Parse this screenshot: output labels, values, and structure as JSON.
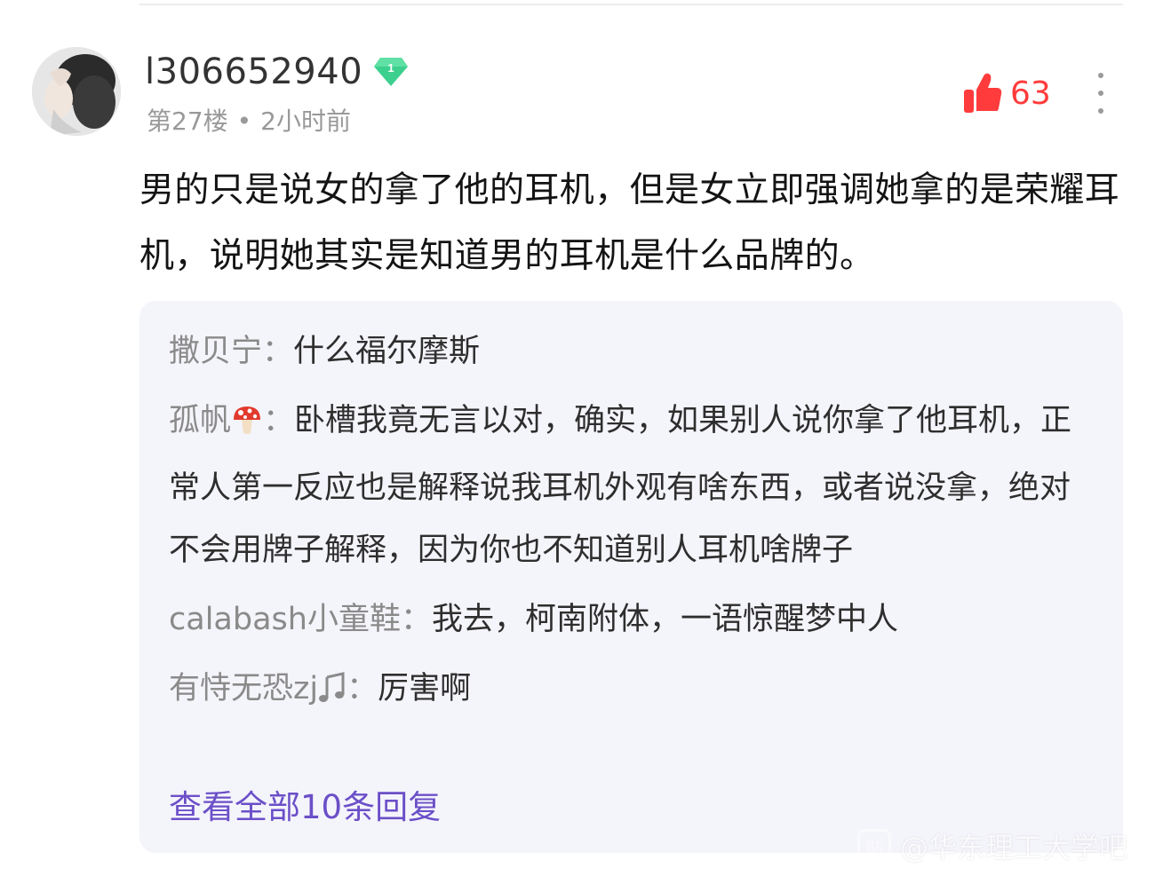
{
  "post": {
    "username": "l306652940",
    "level_badge": "1",
    "floor": "第27楼",
    "separator": "•",
    "time_ago": "2小时前",
    "like_count": "63",
    "content": "男的只是说女的拿了他的耳机，但是女立即强调她拿的是荣耀耳机，说明她其实是知道男的耳机是什么品牌的。"
  },
  "replies": [
    {
      "name": "撒贝宁",
      "colon": "：",
      "text": "什么福尔摩斯",
      "emoji": ""
    },
    {
      "name": "孤帆",
      "colon": "：",
      "text": "卧槽我竟无言以对，确实，如果别人说你拿了他耳机，正常人第一反应也是解释说我耳机外观有啥东西，或者说没拿，绝对不会用牌子解释，因为你也不知道别人耳机啥牌子",
      "emoji": "mushroom"
    },
    {
      "name": "calabash小童鞋",
      "colon": "：",
      "text": "我去，柯南附体，一语惊醒梦中人",
      "emoji": ""
    },
    {
      "name": "有恃无恐zj",
      "colon": "：",
      "text": "厉害啊",
      "emoji": "music-note"
    }
  ],
  "view_all_label": "查看全部10条回复",
  "watermark": "@华东理工大学吧",
  "colors": {
    "like_red": "#ff3b3b",
    "link_purple": "#6b4fc8",
    "badge_green": "#3ccf8e",
    "reply_bg": "#f4f4fb"
  },
  "icons": [
    "thumbs-up-icon",
    "more-vertical-icon",
    "level-diamond-icon",
    "mushroom-emoji",
    "music-note-emoji",
    "tieba-logo-icon"
  ]
}
